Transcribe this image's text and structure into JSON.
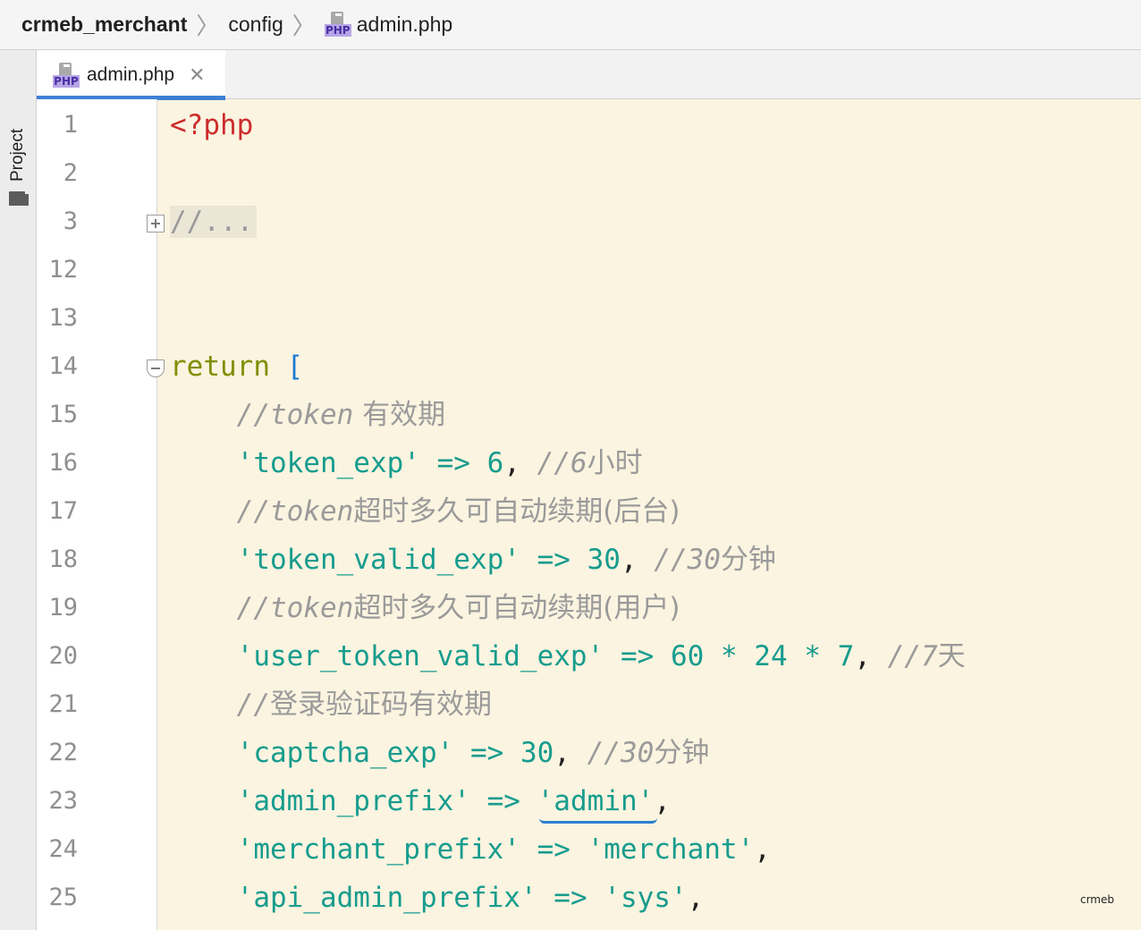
{
  "breadcrumb": {
    "project": "crmeb_merchant",
    "folder": "config",
    "file_icon_label": "PHP",
    "file": "admin.php",
    "separator": "〉"
  },
  "toolstrip": {
    "project_label": "Project",
    "icon": "folder-icon"
  },
  "tabs": [
    {
      "icon_label": "PHP",
      "label": "admin.php",
      "close": "✕",
      "active": true
    }
  ],
  "gutter": {
    "line_numbers": [
      "1",
      "2",
      "3",
      "12",
      "13",
      "14",
      "15",
      "16",
      "17",
      "18",
      "19",
      "20",
      "21",
      "22",
      "23",
      "24",
      "25"
    ]
  },
  "code": {
    "l1": {
      "open_tag": "<?php"
    },
    "l3": {
      "folded": "//..."
    },
    "l14": {
      "kw": "return",
      "bracket": "["
    },
    "l15": {
      "comment": "//token",
      "comment_cjk": " 有效期"
    },
    "l16": {
      "key": "'token_exp'",
      "arrow": "=>",
      "value": "6",
      "comma": ",",
      "comment": "//6",
      "comment_cjk": "小时"
    },
    "l17": {
      "comment": "//token",
      "comment_cjk": "超时多久可自动续期(后台)"
    },
    "l18": {
      "key": "'token_valid_exp'",
      "arrow": "=>",
      "value": "30",
      "comma": ",",
      "comment": "//30",
      "comment_cjk": "分钟"
    },
    "l19": {
      "comment": "//token",
      "comment_cjk": "超时多久可自动续期(用户)"
    },
    "l20": {
      "key": "'user_token_valid_exp'",
      "arrow": "=>",
      "v1": "60",
      "m1": "*",
      "v2": "24",
      "m2": "*",
      "v3": "7",
      "comma": ",",
      "comment": "//7",
      "comment_cjk": "天"
    },
    "l21": {
      "comment": "//",
      "comment_cjk": "登录验证码有效期"
    },
    "l22": {
      "key": "'captcha_exp'",
      "arrow": "=>",
      "value": "30",
      "comma": ",",
      "comment": "//30",
      "comment_cjk": "分钟"
    },
    "l23": {
      "key": "'admin_prefix'",
      "arrow": "=>",
      "value": "'admin'",
      "comma": ","
    },
    "l24": {
      "key": "'merchant_prefix'",
      "arrow": "=>",
      "value": "'merchant'",
      "comma": ","
    },
    "l25": {
      "key": "'api_admin_prefix'",
      "arrow": "=>",
      "value": "'sys'",
      "comma": ","
    }
  },
  "watermark": "crmeb",
  "colors": {
    "editor_bg": "#fbf4e0",
    "php_tag": "#cc2b2b",
    "keyword": "#7f8f00",
    "string": "#179c8e",
    "comment": "#9a9a9a",
    "bracket": "#1c7bd1",
    "tab_accent": "#3d7fd6"
  }
}
